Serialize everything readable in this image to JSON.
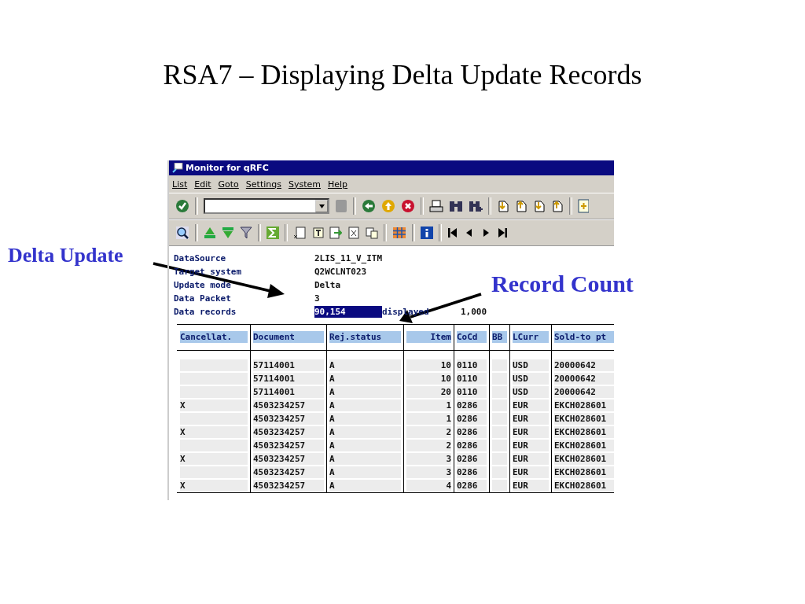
{
  "slide_title": "RSA7 – Displaying Delta Update Records",
  "callouts": [
    {
      "label": "Delta Update",
      "kind": "left"
    },
    {
      "label": "Record Count",
      "kind": "right"
    }
  ],
  "window": {
    "title": "Monitor for qRFC"
  },
  "menu": [
    "List",
    "Edit",
    "Goto",
    "Settings",
    "System",
    "Help"
  ],
  "fields": [
    {
      "label": "DataSource",
      "value": "2LIS_11_V_ITM",
      "highlighted": false
    },
    {
      "label": "Target system",
      "value": "Q2WCLNT023",
      "highlighted": false
    },
    {
      "label": "Update mode",
      "value": "Delta",
      "highlighted": false
    },
    {
      "label": "Data Packet",
      "value": "3",
      "highlighted": false
    },
    {
      "label": "Data records",
      "value": "90,154",
      "highlighted": true
    }
  ],
  "displayed": {
    "label": "displayed",
    "value": "1,000"
  },
  "table": {
    "columns": [
      "Cancellat.",
      "Document",
      "Rej.status",
      "Item",
      "CoCd",
      "BB",
      "LCurr",
      "Sold-to pt"
    ],
    "rows": [
      [
        "",
        "57114001",
        "A",
        "10",
        "0110",
        "",
        "USD",
        "20000642"
      ],
      [
        "",
        "57114001",
        "A",
        "10",
        "0110",
        "",
        "USD",
        "20000642"
      ],
      [
        "",
        "57114001",
        "A",
        "20",
        "0110",
        "",
        "USD",
        "20000642"
      ],
      [
        "X",
        "4503234257",
        "A",
        "1",
        "0286",
        "",
        "EUR",
        "EKCH028601"
      ],
      [
        "",
        "4503234257",
        "A",
        "1",
        "0286",
        "",
        "EUR",
        "EKCH028601"
      ],
      [
        "X",
        "4503234257",
        "A",
        "2",
        "0286",
        "",
        "EUR",
        "EKCH028601"
      ],
      [
        "",
        "4503234257",
        "A",
        "2",
        "0286",
        "",
        "EUR",
        "EKCH028601"
      ],
      [
        "X",
        "4503234257",
        "A",
        "3",
        "0286",
        "",
        "EUR",
        "EKCH028601"
      ],
      [
        "",
        "4503234257",
        "A",
        "3",
        "0286",
        "",
        "EUR",
        "EKCH028601"
      ],
      [
        "X",
        "4503234257",
        "A",
        "4",
        "0286",
        "",
        "EUR",
        "EKCH028601"
      ]
    ]
  }
}
